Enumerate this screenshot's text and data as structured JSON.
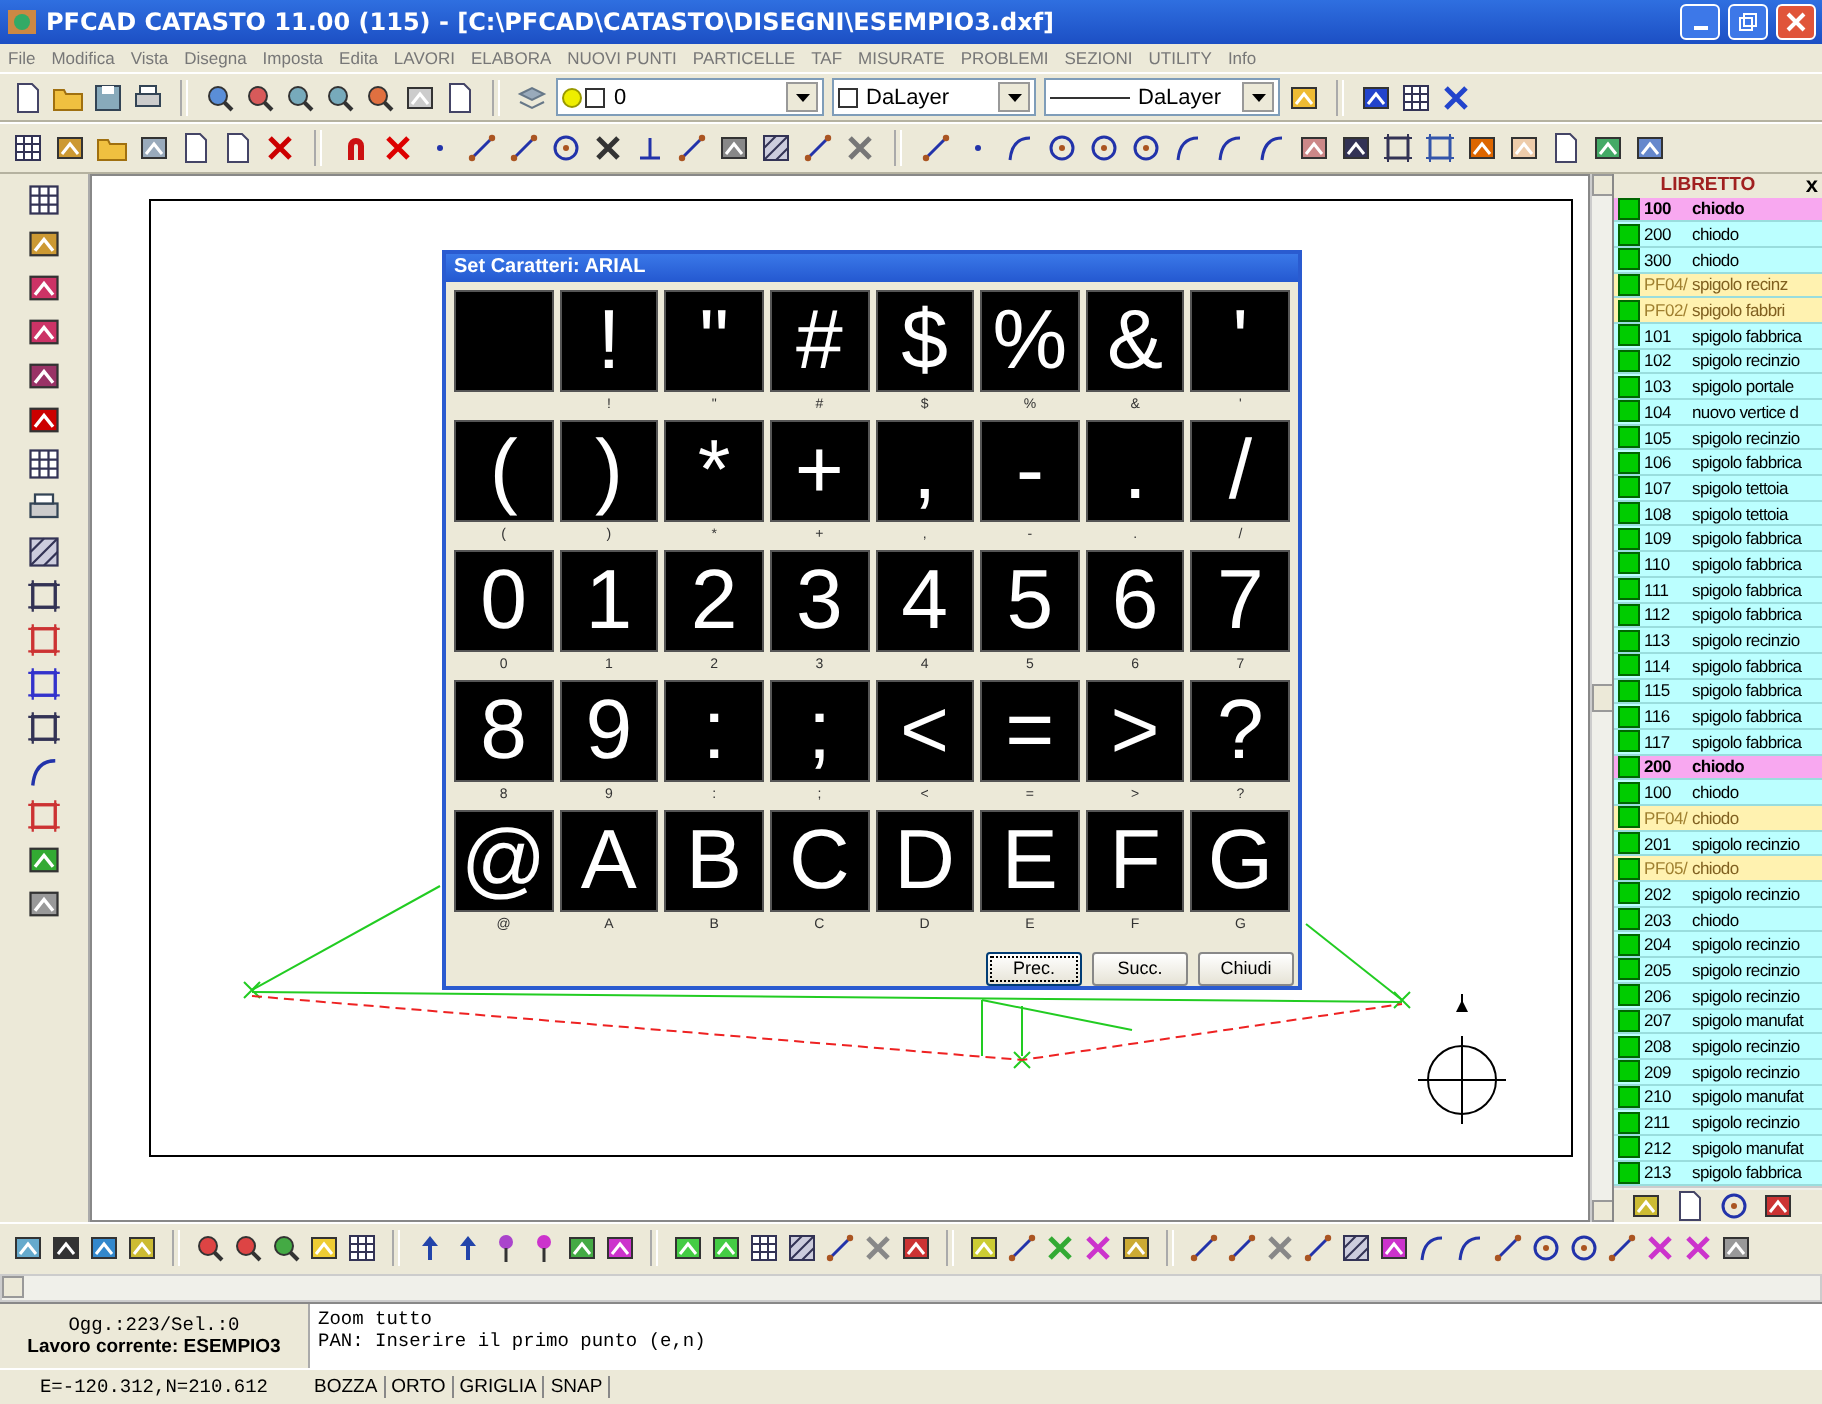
{
  "window": {
    "title": "PFCAD CATASTO 11.00 (115) - [C:\\PFCAD\\CATASTO\\DISEGNI\\ESEMPIO3.dxf]"
  },
  "menu": [
    "File",
    "Modifica",
    "Vista",
    "Disegna",
    "Imposta",
    "Edita",
    "LAVORI",
    "ELABORA",
    "NUOVI PUNTI",
    "PARTICELLE",
    "TAF",
    "MISURATE",
    "PROBLEMI",
    "SEZIONI",
    "UTILITY",
    "Info"
  ],
  "dropdowns": [
    {
      "kind": "layer",
      "value": "0"
    },
    {
      "kind": "swatch",
      "value": "DaLayer"
    },
    {
      "kind": "linetype",
      "value": "DaLayer"
    }
  ],
  "dialog": {
    "title": "Set Caratteri: ARIAL",
    "leading_blank_tile": true,
    "tiles": [
      {
        "glyph": "!",
        "caption": "!"
      },
      {
        "glyph": "\"",
        "caption": "\""
      },
      {
        "glyph": "#",
        "caption": "#"
      },
      {
        "glyph": "$",
        "caption": "$"
      },
      {
        "glyph": "%",
        "caption": "%"
      },
      {
        "glyph": "&",
        "caption": "&"
      },
      {
        "glyph": "'",
        "caption": "'"
      },
      {
        "glyph": "(",
        "caption": "("
      },
      {
        "glyph": ")",
        "caption": ")"
      },
      {
        "glyph": "*",
        "caption": "*"
      },
      {
        "glyph": "+",
        "caption": "+"
      },
      {
        "glyph": ",",
        "caption": ","
      },
      {
        "glyph": "-",
        "caption": "-"
      },
      {
        "glyph": ".",
        "caption": "."
      },
      {
        "glyph": "/",
        "caption": "/"
      },
      {
        "glyph": "0",
        "caption": "0"
      },
      {
        "glyph": "1",
        "caption": "1"
      },
      {
        "glyph": "2",
        "caption": "2"
      },
      {
        "glyph": "3",
        "caption": "3"
      },
      {
        "glyph": "4",
        "caption": "4"
      },
      {
        "glyph": "5",
        "caption": "5"
      },
      {
        "glyph": "6",
        "caption": "6"
      },
      {
        "glyph": "7",
        "caption": "7"
      },
      {
        "glyph": "8",
        "caption": "8"
      },
      {
        "glyph": "9",
        "caption": "9"
      },
      {
        "glyph": ":",
        "caption": ":"
      },
      {
        "glyph": ";",
        "caption": ";"
      },
      {
        "glyph": "<",
        "caption": "<"
      },
      {
        "glyph": "=",
        "caption": "="
      },
      {
        "glyph": ">",
        "caption": ">"
      },
      {
        "glyph": "?",
        "caption": "?"
      },
      {
        "glyph": "@",
        "caption": "@"
      },
      {
        "glyph": "A",
        "caption": "A"
      },
      {
        "glyph": "B",
        "caption": "B"
      },
      {
        "glyph": "C",
        "caption": "C"
      },
      {
        "glyph": "D",
        "caption": "D"
      },
      {
        "glyph": "E",
        "caption": "E"
      },
      {
        "glyph": "F",
        "caption": "F"
      },
      {
        "glyph": "G",
        "caption": "G"
      }
    ],
    "buttons": [
      {
        "label": "Prec.",
        "focused": true
      },
      {
        "label": "Succ.",
        "focused": false
      },
      {
        "label": "Chiudi",
        "focused": false
      }
    ]
  },
  "libretto": {
    "title": "LIBRETTO",
    "close": "x",
    "rows": [
      {
        "kind": "station",
        "number": "100",
        "description": "chiodo"
      },
      {
        "kind": "point",
        "number": "200",
        "description": "chiodo"
      },
      {
        "kind": "point",
        "number": "300",
        "description": "chiodo"
      },
      {
        "kind": "reference",
        "number": "PF04/",
        "description": "spigolo recinz"
      },
      {
        "kind": "reference",
        "number": "PF02/",
        "description": "spigolo fabbri"
      },
      {
        "kind": "point",
        "number": "101",
        "description": "spigolo fabbrica"
      },
      {
        "kind": "point",
        "number": "102",
        "description": "spigolo recinzio"
      },
      {
        "kind": "point",
        "number": "103",
        "description": "spigolo portale"
      },
      {
        "kind": "point",
        "number": "104",
        "description": "nuovo vertice d"
      },
      {
        "kind": "point",
        "number": "105",
        "description": "spigolo recinzio"
      },
      {
        "kind": "point",
        "number": "106",
        "description": "spigolo fabbrica"
      },
      {
        "kind": "point",
        "number": "107",
        "description": "spigolo tettoia"
      },
      {
        "kind": "point",
        "number": "108",
        "description": "spigolo tettoia"
      },
      {
        "kind": "point",
        "number": "109",
        "description": "spigolo fabbrica"
      },
      {
        "kind": "point",
        "number": "110",
        "description": "spigolo fabbrica"
      },
      {
        "kind": "point",
        "number": "111",
        "description": "spigolo fabbrica"
      },
      {
        "kind": "point",
        "number": "112",
        "description": "spigolo fabbrica"
      },
      {
        "kind": "point",
        "number": "113",
        "description": "spigolo recinzio"
      },
      {
        "kind": "point",
        "number": "114",
        "description": "spigolo fabbrica"
      },
      {
        "kind": "point",
        "number": "115",
        "description": "spigolo fabbrica"
      },
      {
        "kind": "point",
        "number": "116",
        "description": "spigolo fabbrica"
      },
      {
        "kind": "point",
        "number": "117",
        "description": "spigolo fabbrica"
      },
      {
        "kind": "station",
        "number": "200",
        "description": "chiodo"
      },
      {
        "kind": "point",
        "number": "100",
        "description": "chiodo"
      },
      {
        "kind": "reference",
        "number": "PF04/",
        "description": "chiodo"
      },
      {
        "kind": "point",
        "number": "201",
        "description": "spigolo recinzio"
      },
      {
        "kind": "reference",
        "number": "PF05/",
        "description": "chiodo"
      },
      {
        "kind": "point",
        "number": "202",
        "description": "spigolo recinzio"
      },
      {
        "kind": "point",
        "number": "203",
        "description": "chiodo"
      },
      {
        "kind": "point",
        "number": "204",
        "description": "spigolo recinzio"
      },
      {
        "kind": "point",
        "number": "205",
        "description": "spigolo recinzio"
      },
      {
        "kind": "point",
        "number": "206",
        "description": "spigolo recinzio"
      },
      {
        "kind": "point",
        "number": "207",
        "description": "spigolo manufat"
      },
      {
        "kind": "point",
        "number": "208",
        "description": "spigolo recinzio"
      },
      {
        "kind": "point",
        "number": "209",
        "description": "spigolo recinzio"
      },
      {
        "kind": "point",
        "number": "210",
        "description": "spigolo manufat"
      },
      {
        "kind": "point",
        "number": "211",
        "description": "spigolo recinzio"
      },
      {
        "kind": "point",
        "number": "212",
        "description": "spigolo manufat"
      },
      {
        "kind": "point",
        "number": "213",
        "description": "spigolo fabbrica"
      }
    ]
  },
  "command": {
    "objects": "Ogg.:223/Sel.:0",
    "job_label": "Lavoro corrente: ESEMPIO3",
    "lines": [
      "Zoom tutto",
      "PAN: Inserire il primo punto (e,n)"
    ]
  },
  "status_bar": {
    "coordinates": "E=-120.312,N=210.612",
    "modes": [
      "BOZZA",
      "ORTO",
      "GRIGLIA",
      "SNAP"
    ]
  }
}
